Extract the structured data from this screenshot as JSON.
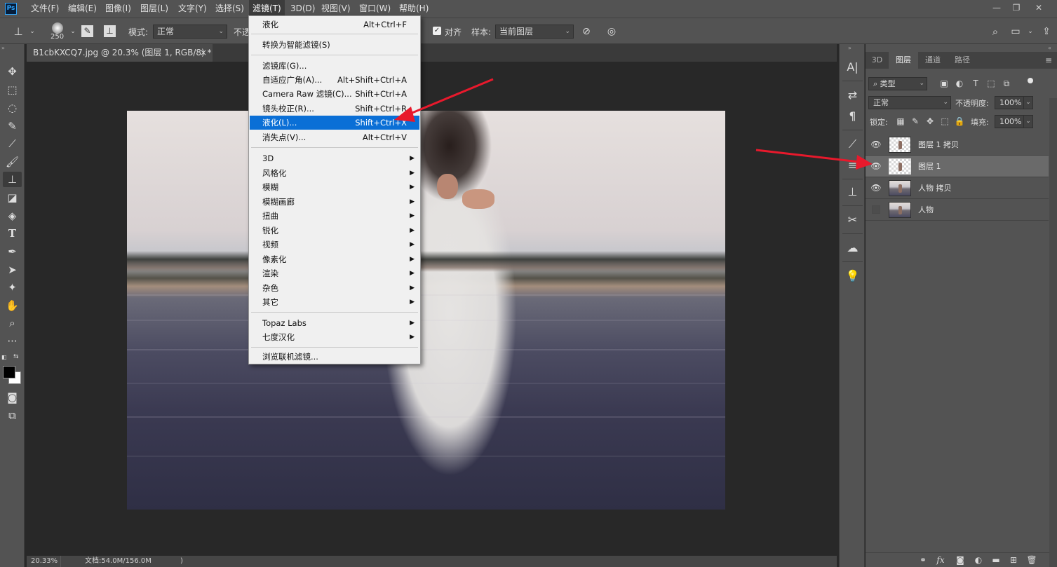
{
  "app": {
    "logo": "Ps",
    "menus": [
      "文件(F)",
      "编辑(E)",
      "图像(I)",
      "图层(L)",
      "文字(Y)",
      "选择(S)",
      "滤镜(T)",
      "3D(D)",
      "视图(V)",
      "窗口(W)",
      "帮助(H)"
    ],
    "active_menu": "滤镜(T)",
    "window_controls": [
      "minimize-icon",
      "restore-icon",
      "close-icon"
    ]
  },
  "options_bar": {
    "brush_size": "250",
    "mode_label": "模式:",
    "mode_value": "正常",
    "opacity_label_partial": "不透",
    "align_checked": true,
    "align_label": "对齐",
    "sample_label": "样本:",
    "sample_value": "当前图层"
  },
  "document_tab": {
    "title": "B1cbKXCQ7.jpg @ 20.3% (图层 1, RGB/8) *",
    "close": "×"
  },
  "filter_menu": {
    "groups": [
      [
        {
          "label": "液化",
          "shortcut": "Alt+Ctrl+F"
        }
      ],
      [
        {
          "label": "转换为智能滤镜(S)",
          "shortcut": ""
        }
      ],
      [
        {
          "label": "滤镜库(G)...",
          "shortcut": ""
        },
        {
          "label": "自适应广角(A)...",
          "shortcut": "Alt+Shift+Ctrl+A"
        },
        {
          "label": "Camera Raw 滤镜(C)...",
          "shortcut": "Shift+Ctrl+A"
        },
        {
          "label": "镜头校正(R)...",
          "shortcut": "Shift+Ctrl+R"
        },
        {
          "label": "液化(L)...",
          "shortcut": "Shift+Ctrl+X",
          "highlighted": true
        },
        {
          "label": "消失点(V)...",
          "shortcut": "Alt+Ctrl+V"
        }
      ],
      [
        {
          "label": "3D",
          "submenu": true
        },
        {
          "label": "风格化",
          "submenu": true
        },
        {
          "label": "模糊",
          "submenu": true
        },
        {
          "label": "模糊画廊",
          "submenu": true
        },
        {
          "label": "扭曲",
          "submenu": true
        },
        {
          "label": "锐化",
          "submenu": true
        },
        {
          "label": "视频",
          "submenu": true
        },
        {
          "label": "像素化",
          "submenu": true
        },
        {
          "label": "渲染",
          "submenu": true
        },
        {
          "label": "杂色",
          "submenu": true
        },
        {
          "label": "其它",
          "submenu": true
        }
      ],
      [
        {
          "label": "Topaz Labs",
          "submenu": true
        },
        {
          "label": "七度汉化",
          "submenu": true
        }
      ],
      [
        {
          "label": "浏览联机滤镜...",
          "shortcut": ""
        }
      ]
    ]
  },
  "layers_panel": {
    "tabs": [
      "3D",
      "图层",
      "通道",
      "路径"
    ],
    "active_tab": "图层",
    "filter_kind": "类型",
    "blend_mode": "正常",
    "opacity_label": "不透明度:",
    "opacity_value": "100%",
    "lock_label": "锁定:",
    "fill_label": "填充:",
    "fill_value": "100%",
    "layers": [
      {
        "name": "图层 1 拷贝",
        "visible": true,
        "thumb": "transparent",
        "selected": false
      },
      {
        "name": "图层 1",
        "visible": true,
        "thumb": "transparent",
        "selected": true
      },
      {
        "name": "人物 拷贝",
        "visible": true,
        "thumb": "photo",
        "selected": false
      },
      {
        "name": "人物",
        "visible": false,
        "thumb": "photo",
        "selected": false
      }
    ]
  },
  "status_bar": {
    "zoom": "20.33%",
    "doc_info": "文档:54.0M/156.0M",
    "more": ")"
  },
  "colors": {
    "highlight": "#0a6fd6",
    "annotation_arrow": "#e8192c",
    "panel_bg": "#535353"
  }
}
